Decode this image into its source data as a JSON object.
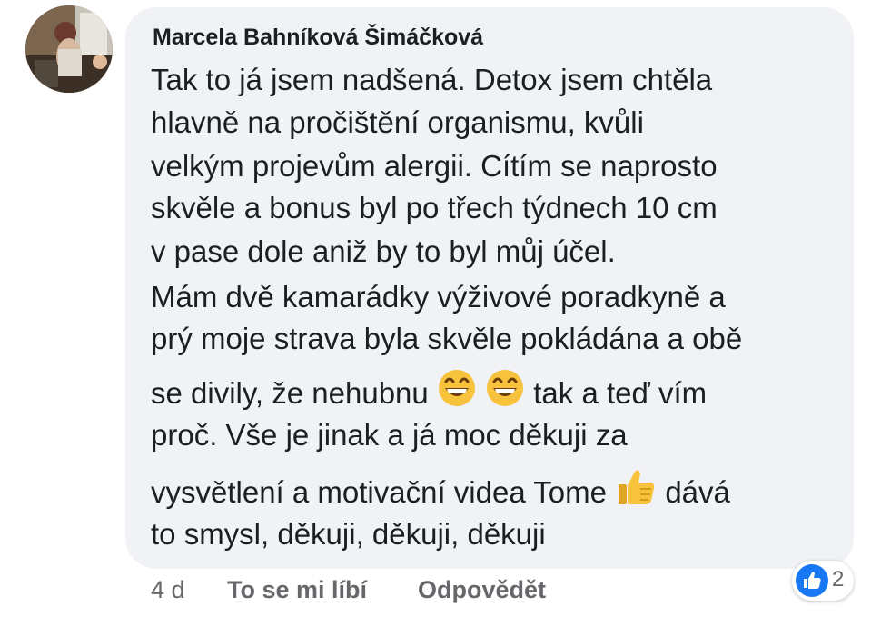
{
  "comment": {
    "author": "Marcela Bahníková Šimáčková",
    "lines": {
      "l1": "Tak to já jsem nadšená. Detox jsem chtěla",
      "l2": "hlavně na pročištění organismu, kvůli",
      "l3": "velkým projevům alergii. Cítím se naprosto",
      "l4": "skvěle a bonus byl po třech týdnech 10 cm",
      "l5": "v pase dole aniž by to byl můj účel.",
      "l6": "Mám dvě kamarádky výživové poradkyně a",
      "l7": "prý moje strava byla skvěle pokládána a obě",
      "l8a": "se divily, že nehubnu",
      "l8b": "tak a teď vím",
      "l9": "proč. Vše je jinak a já moc děkuji za",
      "l10a": "vysvětlení a motivační videa Tome",
      "l10b": "dává",
      "l11": "to smysl, děkuji, děkuji, děkuji"
    },
    "emojis": [
      "grinning-face",
      "grinning-face",
      "thumbs-up"
    ]
  },
  "footer": {
    "time": "4 d",
    "like_label": "To se mi líbí",
    "reply_label": "Odpovědět"
  },
  "reactions": {
    "type": "like",
    "count": "2"
  },
  "colors": {
    "bubble": "#f0f2f5",
    "text": "#1c1e21",
    "meta": "#65676b",
    "like_blue": "#1877f2",
    "emoji_yellow": "#f7c23c"
  }
}
